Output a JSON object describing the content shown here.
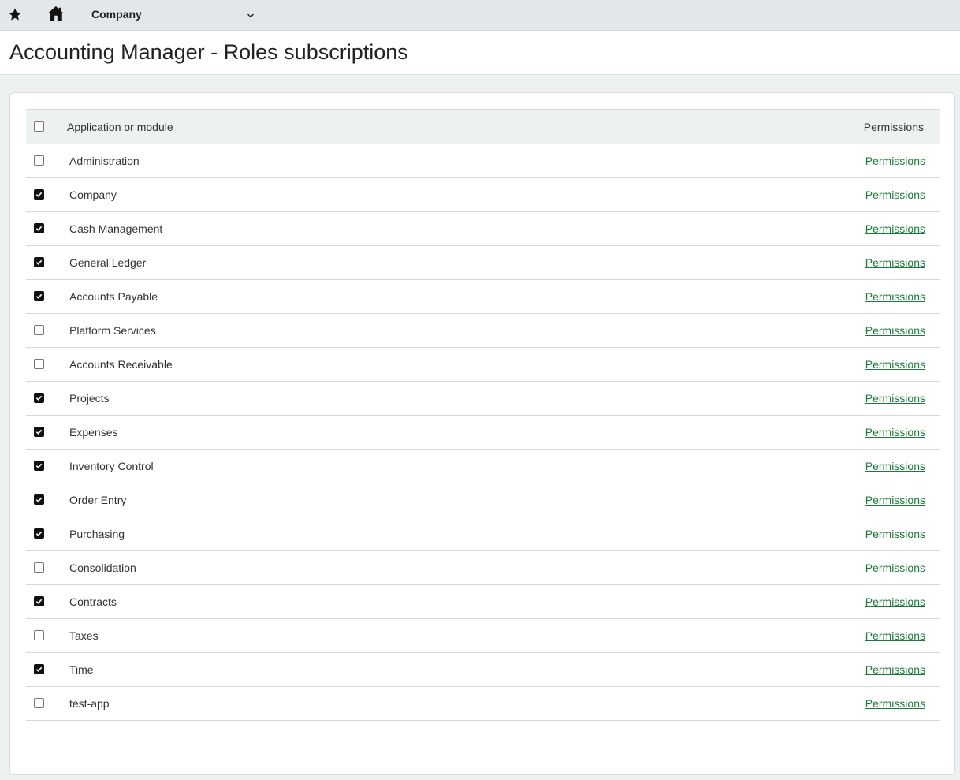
{
  "topbar": {
    "favorites_icon": "star-icon",
    "home_icon": "home-icon",
    "company_menu": "Company",
    "dropdown_icon": "chevron-down-icon"
  },
  "page": {
    "title": "Accounting Manager - Roles subscriptions"
  },
  "table": {
    "headers": {
      "select_all_checked": false,
      "application": "Application or module",
      "permissions": "Permissions"
    },
    "rows": [
      {
        "name": "Administration",
        "checked": false,
        "link": "Permissions"
      },
      {
        "name": "Company",
        "checked": true,
        "link": "Permissions"
      },
      {
        "name": "Cash Management",
        "checked": true,
        "link": "Permissions"
      },
      {
        "name": "General Ledger",
        "checked": true,
        "link": "Permissions"
      },
      {
        "name": "Accounts Payable",
        "checked": true,
        "link": "Permissions"
      },
      {
        "name": "Platform Services",
        "checked": false,
        "link": "Permissions"
      },
      {
        "name": "Accounts Receivable",
        "checked": false,
        "link": "Permissions"
      },
      {
        "name": "Projects",
        "checked": true,
        "link": "Permissions"
      },
      {
        "name": "Expenses",
        "checked": true,
        "link": "Permissions"
      },
      {
        "name": "Inventory Control",
        "checked": true,
        "link": "Permissions"
      },
      {
        "name": "Order Entry",
        "checked": true,
        "link": "Permissions"
      },
      {
        "name": "Purchasing",
        "checked": true,
        "link": "Permissions"
      },
      {
        "name": "Consolidation",
        "checked": false,
        "link": "Permissions"
      },
      {
        "name": "Contracts",
        "checked": true,
        "link": "Permissions"
      },
      {
        "name": "Taxes",
        "checked": false,
        "link": "Permissions"
      },
      {
        "name": "Time",
        "checked": true,
        "link": "Permissions"
      },
      {
        "name": "test-app",
        "checked": false,
        "link": "Permissions"
      }
    ]
  },
  "colors": {
    "link": "#1d7a3a",
    "topbar_bg": "#e4e7e9",
    "page_bg": "#eef1f2"
  }
}
